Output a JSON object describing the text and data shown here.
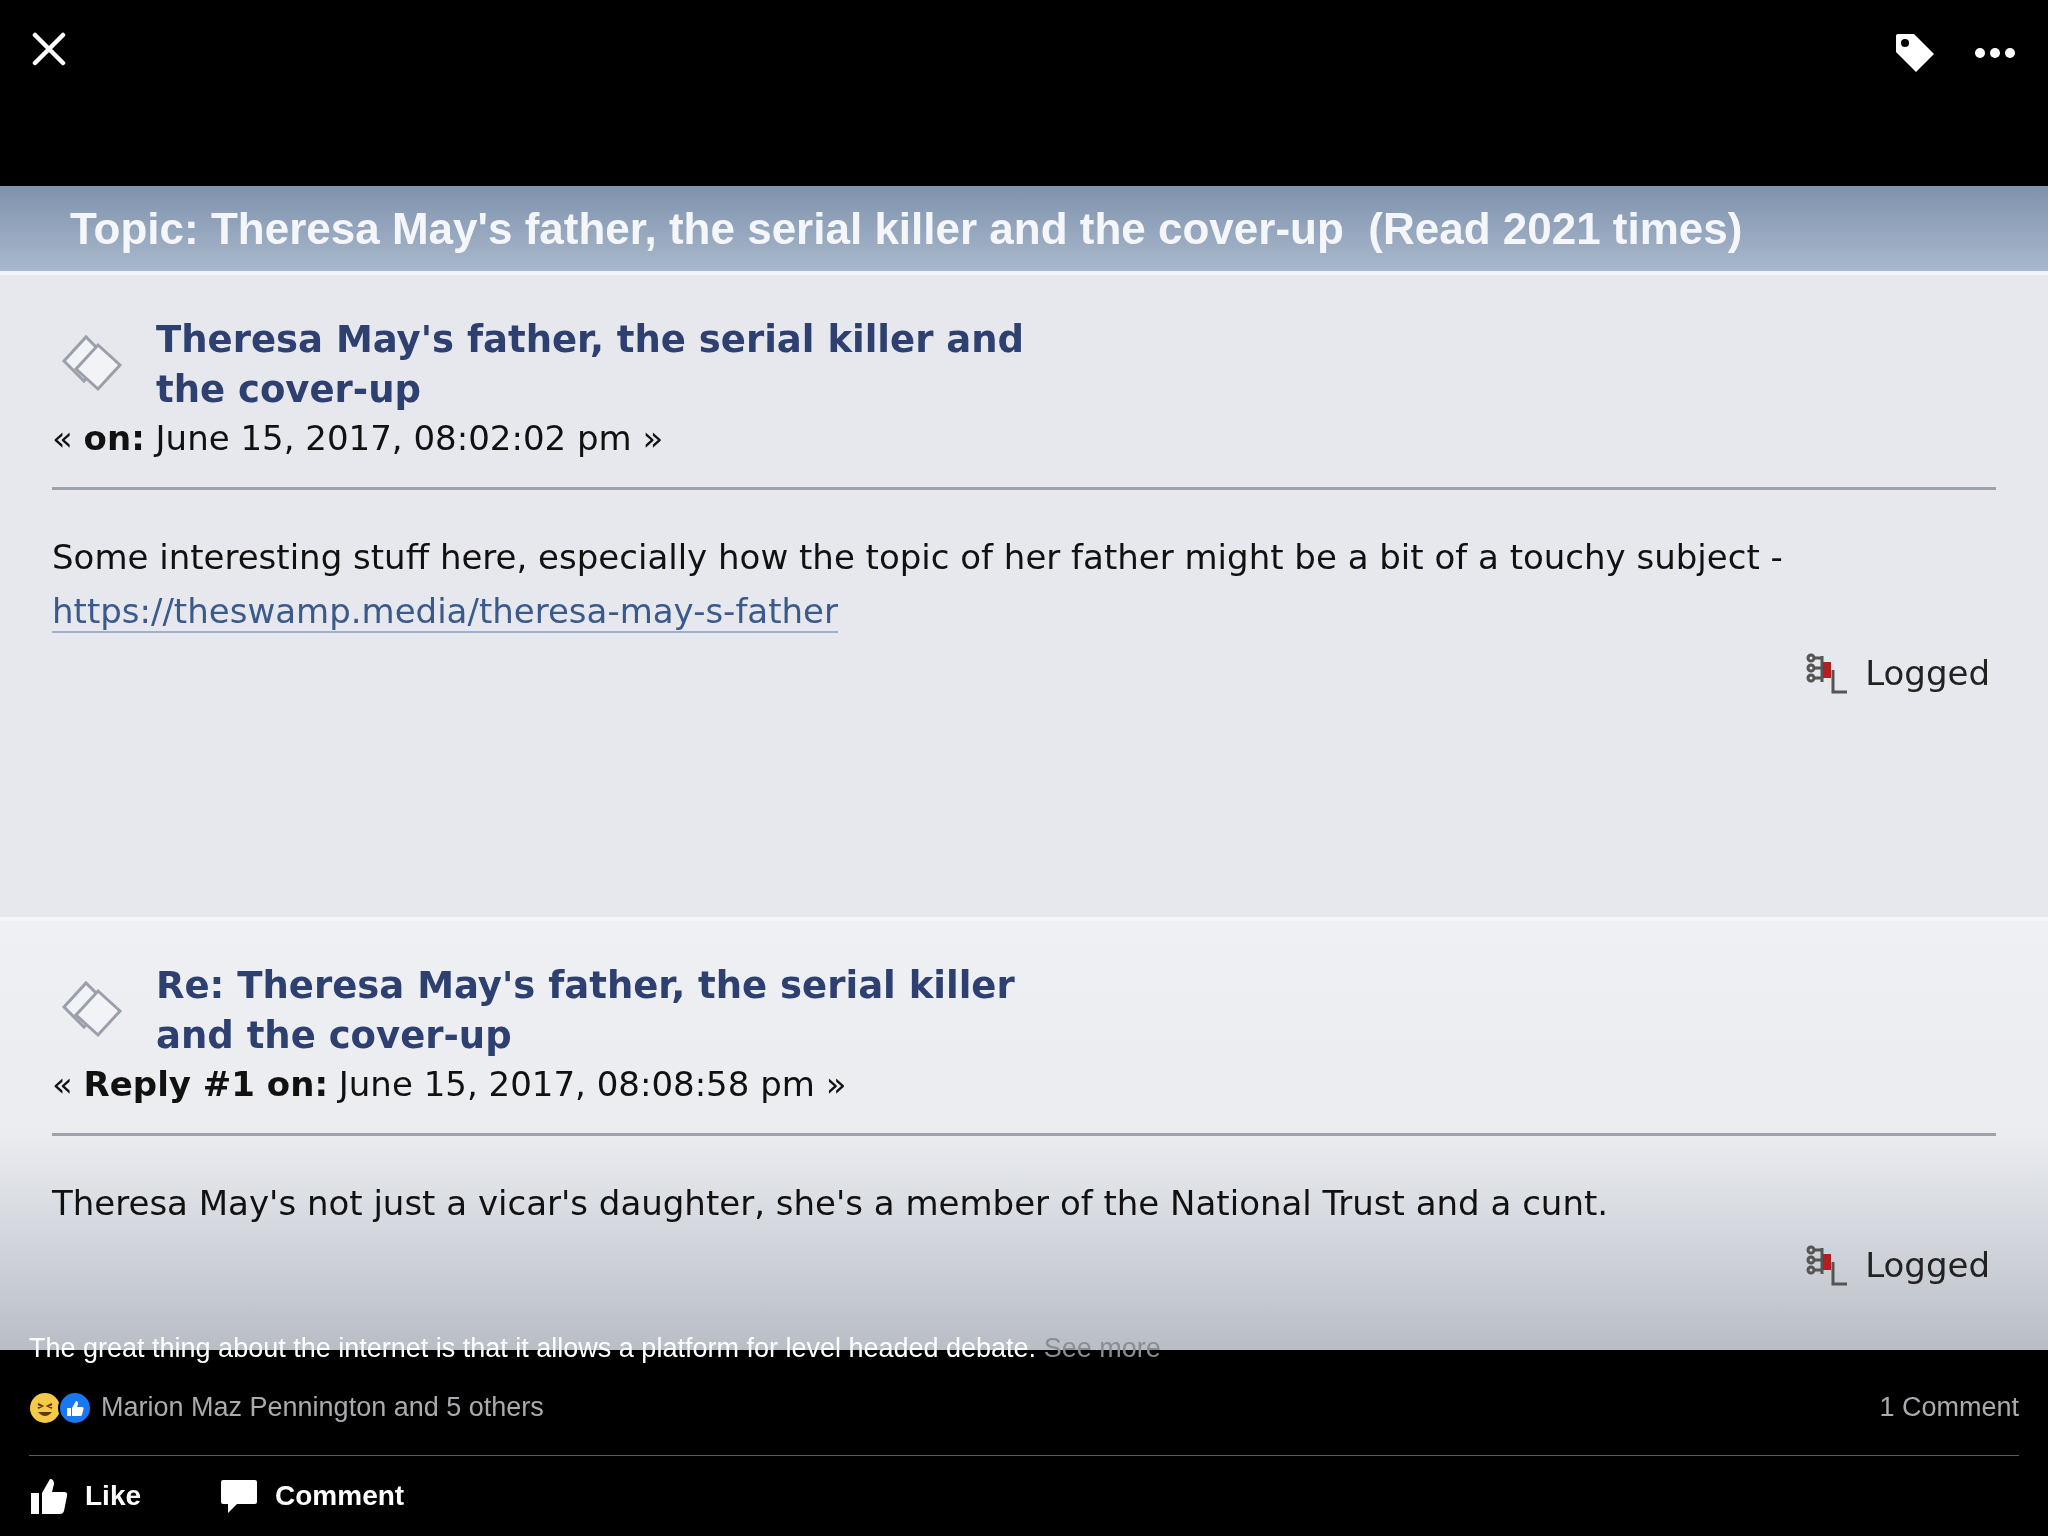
{
  "topic_header": "Topic: Theresa May's father, the serial killer and the cover-up  (Read 2021 times)",
  "posts": [
    {
      "title": "Theresa May's father, the serial killer and the cover-up",
      "meta": "« **on:** June 15, 2017, 08:02:02 pm »",
      "body": "Some interesting stuff here, especially how the topic of her father might be a bit of a touchy subject -",
      "link": "https://theswamp.media/theresa-may-s-father",
      "status": "Logged"
    },
    {
      "title": "Re: Theresa May's father, the serial killer and the cover-up",
      "meta": "« **Reply #1 on:** June 15, 2017, 08:08:58 pm »",
      "body": "Theresa May's not just a vicar's daughter, she's a member of the National Trust and a cunt.",
      "status": "Logged"
    }
  ],
  "caption": {
    "text": "The great thing about the internet is that it allows a platform for level headed debate.",
    "see_more": "See more"
  },
  "reactions": {
    "names": "Marion Maz Pennington and 5 others",
    "comments": "1 Comment"
  },
  "actions": [
    {
      "kind": "like",
      "label": "Like"
    },
    {
      "kind": "comment",
      "label": "Comment"
    }
  ]
}
